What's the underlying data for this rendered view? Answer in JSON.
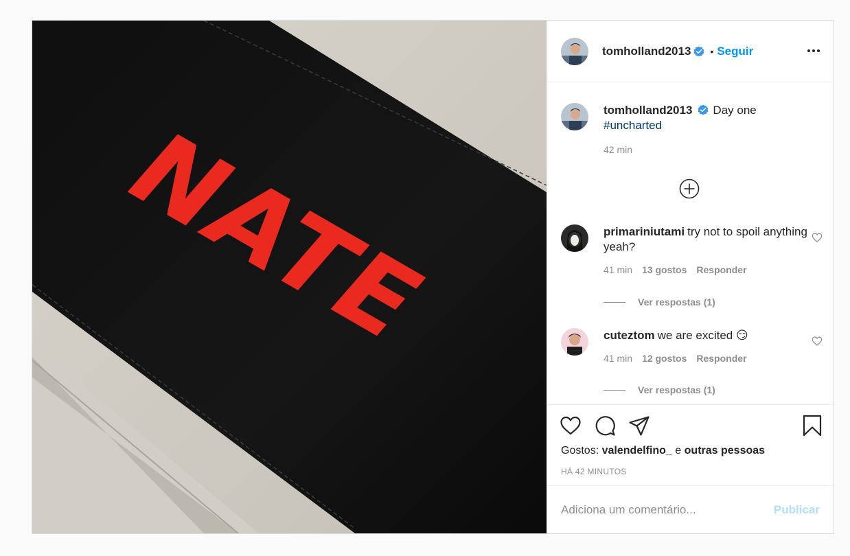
{
  "post": {
    "author": "tomholland2013",
    "follow_separator": "•",
    "follow_label": "Seguir",
    "more_icon": "more-horizontal-icon",
    "image_text": "NATE",
    "caption": {
      "username": "tomholland2013",
      "text": "Day one",
      "hashtag": "#uncharted",
      "time": "42 min"
    },
    "load_more_icon": "plus-circle-icon",
    "comments": [
      {
        "username": "primariniutami",
        "text": "try not to spoil anything yeah?",
        "time": "41 min",
        "likes": "13 gostos",
        "reply_label": "Responder",
        "view_replies": "Ver respostas (1)"
      },
      {
        "username": "cuteztom",
        "text": "we are excited",
        "emoji": "😏",
        "time": "41 min",
        "likes": "12 gostos",
        "reply_label": "Responder",
        "view_replies": "Ver respostas (1)"
      }
    ],
    "likes_prefix": "Gostos:",
    "liked_by": "valendelfino_",
    "likes_joiner": "e",
    "likes_others": "outras pessoas",
    "time_ago": "HÁ 42 MINUTOS",
    "comment_placeholder": "Adiciona um comentário...",
    "publish_label": "Publicar"
  },
  "colors": {
    "accent": "#0095f6",
    "publish_disabled": "#b2dffc",
    "hashtag": "#00376b",
    "muted": "#8e8e8e"
  }
}
